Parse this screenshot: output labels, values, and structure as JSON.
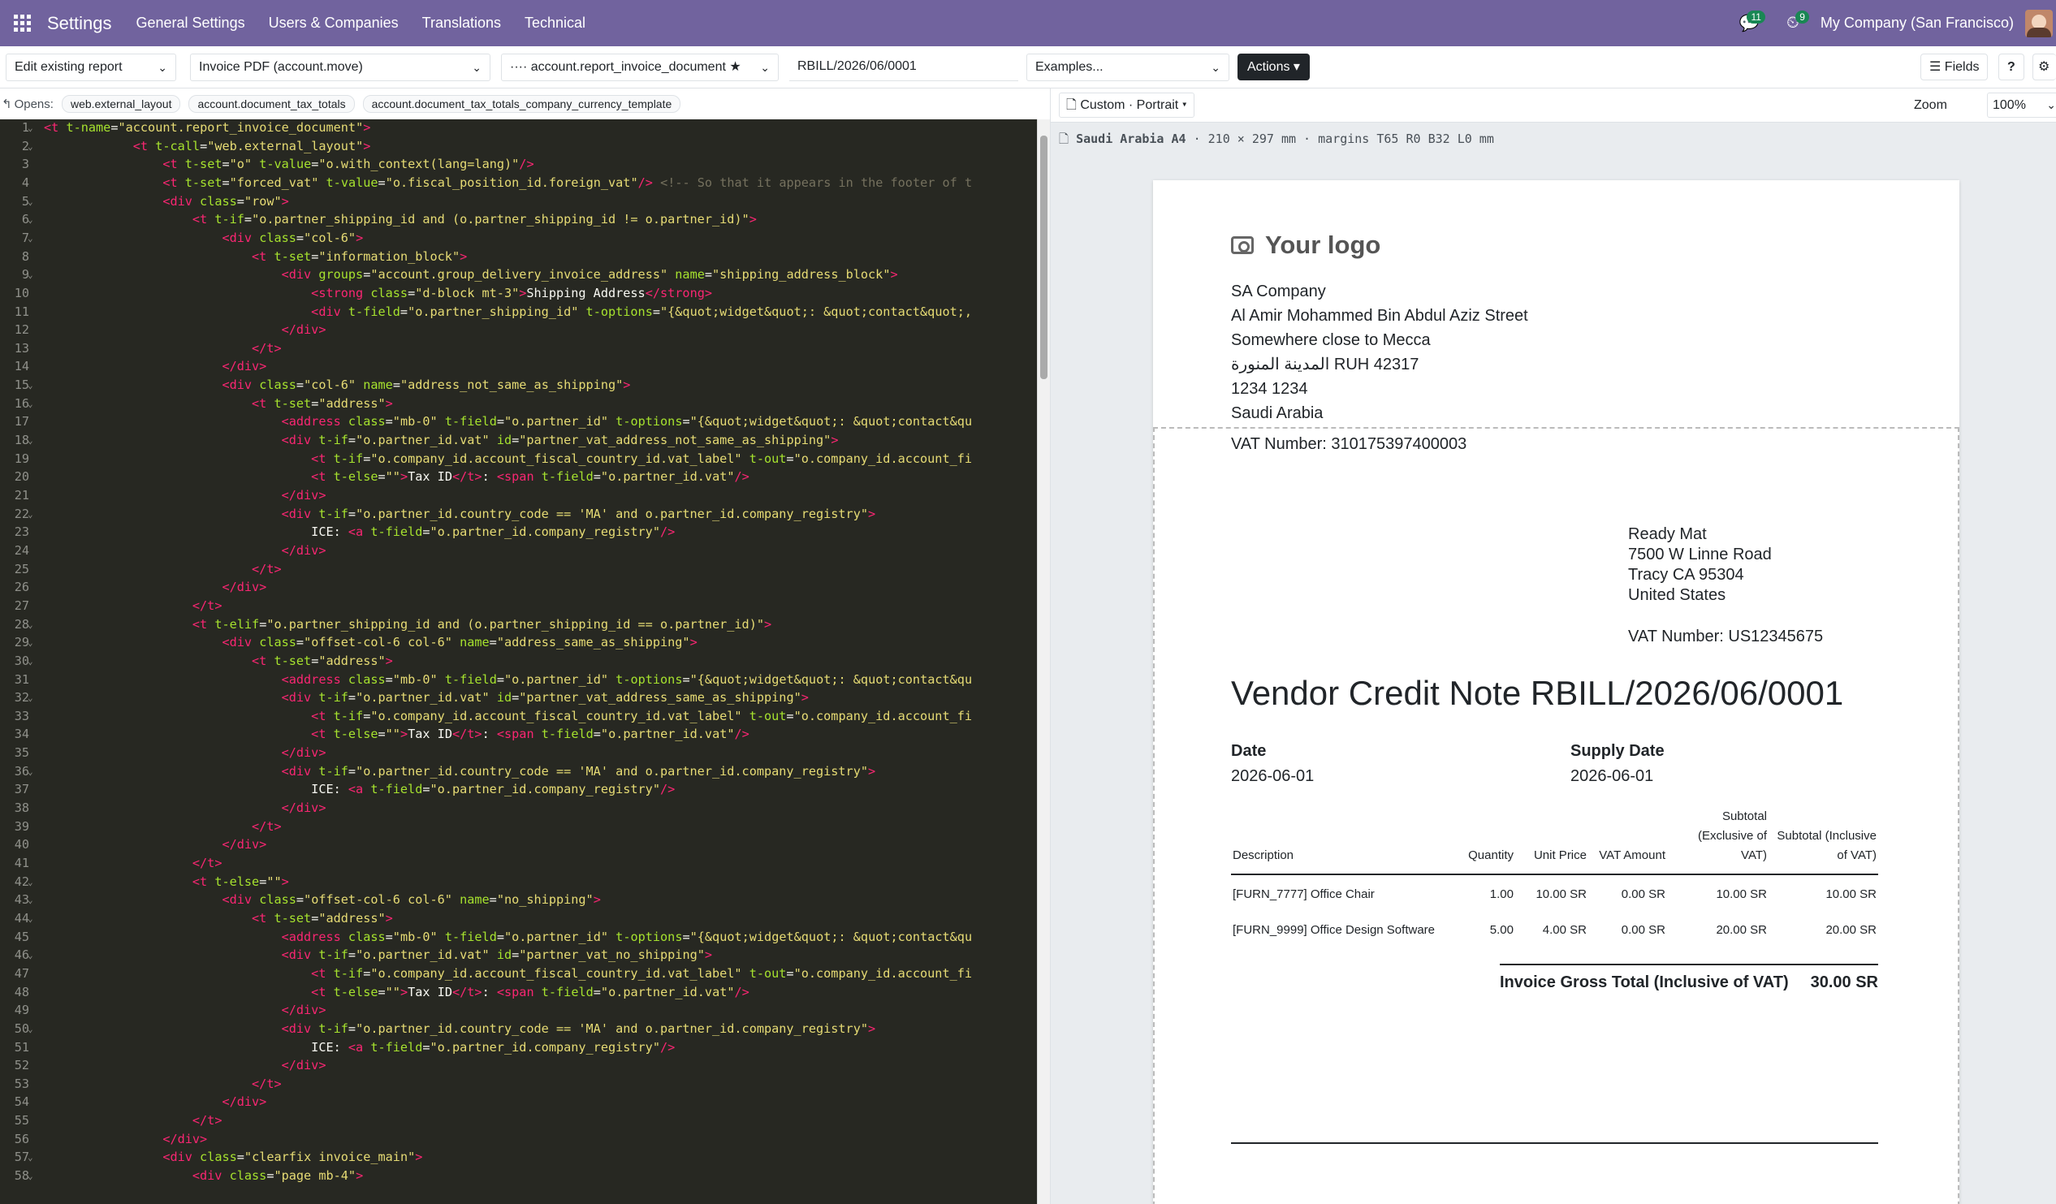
{
  "topbar": {
    "brand": "Settings",
    "menus": [
      "General Settings",
      "Users & Companies",
      "Translations",
      "Technical"
    ],
    "messages_badge": "11",
    "activities_badge": "9",
    "company": "My Company (San Francisco)"
  },
  "controls": {
    "mode": "Edit existing report",
    "report": "Invoice PDF (account.move)",
    "template": "···· account.report_invoice_document ★",
    "record": "RBILL/2026/06/0001",
    "examples": "Examples...",
    "actions": "Actions",
    "fields": "Fields",
    "help": "?",
    "settings_icon": "gear-icon"
  },
  "opens": {
    "label": "Opens:",
    "items": [
      "web.external_layout",
      "account.document_tax_totals",
      "account.document_tax_totals_company_currency_template"
    ]
  },
  "editor": {
    "lines": [
      "<t t-name=\"account.report_invoice_document\">",
      "            <t t-call=\"web.external_layout\">",
      "                <t t-set=\"o\" t-value=\"o.with_context(lang=lang)\"/>",
      "                <t t-set=\"forced_vat\" t-value=\"o.fiscal_position_id.foreign_vat\"/> <!-- So that it appears in the footer of t",
      "                <div class=\"row\">",
      "                    <t t-if=\"o.partner_shipping_id and (o.partner_shipping_id != o.partner_id)\">",
      "                        <div class=\"col-6\">",
      "                            <t t-set=\"information_block\">",
      "                                <div groups=\"account.group_delivery_invoice_address\" name=\"shipping_address_block\">",
      "                                    <strong class=\"d-block mt-3\">Shipping Address</strong>",
      "                                    <div t-field=\"o.partner_shipping_id\" t-options=\"{&quot;widget&quot;: &quot;contact&quot;,",
      "                                </div>",
      "                            </t>",
      "                        </div>",
      "                        <div class=\"col-6\" name=\"address_not_same_as_shipping\">",
      "                            <t t-set=\"address\">",
      "                                <address class=\"mb-0\" t-field=\"o.partner_id\" t-options=\"{&quot;widget&quot;: &quot;contact&qu",
      "                                <div t-if=\"o.partner_id.vat\" id=\"partner_vat_address_not_same_as_shipping\">",
      "                                    <t t-if=\"o.company_id.account_fiscal_country_id.vat_label\" t-out=\"o.company_id.account_fi",
      "                                    <t t-else=\"\">Tax ID</t>: <span t-field=\"o.partner_id.vat\"/>",
      "                                </div>",
      "                                <div t-if=\"o.partner_id.country_code == 'MA' and o.partner_id.company_registry\">",
      "                                    ICE: <a t-field=\"o.partner_id.company_registry\"/>",
      "                                </div>",
      "                            </t>",
      "                        </div>",
      "                    </t>",
      "                    <t t-elif=\"o.partner_shipping_id and (o.partner_shipping_id == o.partner_id)\">",
      "                        <div class=\"offset-col-6 col-6\" name=\"address_same_as_shipping\">",
      "                            <t t-set=\"address\">",
      "                                <address class=\"mb-0\" t-field=\"o.partner_id\" t-options=\"{&quot;widget&quot;: &quot;contact&qu",
      "                                <div t-if=\"o.partner_id.vat\" id=\"partner_vat_address_same_as_shipping\">",
      "                                    <t t-if=\"o.company_id.account_fiscal_country_id.vat_label\" t-out=\"o.company_id.account_fi",
      "                                    <t t-else=\"\">Tax ID</t>: <span t-field=\"o.partner_id.vat\"/>",
      "                                </div>",
      "                                <div t-if=\"o.partner_id.country_code == 'MA' and o.partner_id.company_registry\">",
      "                                    ICE: <a t-field=\"o.partner_id.company_registry\"/>",
      "                                </div>",
      "                            </t>",
      "                        </div>",
      "                    </t>",
      "                    <t t-else=\"\">",
      "                        <div class=\"offset-col-6 col-6\" name=\"no_shipping\">",
      "                            <t t-set=\"address\">",
      "                                <address class=\"mb-0\" t-field=\"o.partner_id\" t-options=\"{&quot;widget&quot;: &quot;contact&qu",
      "                                <div t-if=\"o.partner_id.vat\" id=\"partner_vat_no_shipping\">",
      "                                    <t t-if=\"o.company_id.account_fiscal_country_id.vat_label\" t-out=\"o.company_id.account_fi",
      "                                    <t t-else=\"\">Tax ID</t>: <span t-field=\"o.partner_id.vat\"/>",
      "                                </div>",
      "                                <div t-if=\"o.partner_id.country_code == 'MA' and o.partner_id.company_registry\">",
      "                                    ICE: <a t-field=\"o.partner_id.company_registry\"/>",
      "                                </div>",
      "                            </t>",
      "                        </div>",
      "                    </t>",
      "                </div>",
      "                <div class=\"clearfix invoice_main\">",
      "                    <div class=\"page mb-4\">"
    ],
    "folded_lines": [
      1,
      2,
      5,
      6,
      7,
      9,
      15,
      16,
      18,
      22,
      28,
      29,
      30,
      32,
      36,
      42,
      43,
      44,
      46,
      50,
      57,
      58
    ]
  },
  "preview": {
    "layout_selector": "Custom · Portrait",
    "zoom_label": "Zoom",
    "zoom_value": "100%",
    "paper_name": "Saudi Arabia A4",
    "paper_info": "· 210 × 297 mm · margins T65 R0 B32 L0 mm"
  },
  "invoice": {
    "logo_text": "Your logo",
    "company_lines": [
      "SA Company",
      "Al Amir Mohammed Bin Abdul Aziz Street",
      "Somewhere close to Mecca",
      "المدينة المنورة RUH 42317",
      "1234 1234",
      "Saudi Arabia"
    ],
    "company_vat": "VAT Number: 310175397400003",
    "customer_lines": [
      "Ready Mat",
      "7500 W Linne Road",
      "Tracy CA 95304",
      "United States"
    ],
    "customer_vat": "VAT Number: US12345675",
    "title": "Vendor Credit Note RBILL/2026/06/0001",
    "date_label": "Date",
    "date_value": "2026-06-01",
    "supply_label": "Supply Date",
    "supply_value": "2026-06-01",
    "columns": [
      "Description",
      "Quantity",
      "Unit Price",
      "VAT Amount",
      "Subtotal (Exclusive of VAT)",
      "Subtotal (Inclusive of VAT)"
    ],
    "rows": [
      [
        "[FURN_7777] Office Chair",
        "1.00",
        "10.00 SR",
        "0.00 SR",
        "10.00 SR",
        "10.00 SR"
      ],
      [
        "[FURN_9999] Office Design Software",
        "5.00",
        "4.00 SR",
        "0.00 SR",
        "20.00 SR",
        "20.00 SR"
      ]
    ],
    "total_label": "Invoice Gross Total (Inclusive of VAT)",
    "total_value": "30.00 SR"
  }
}
